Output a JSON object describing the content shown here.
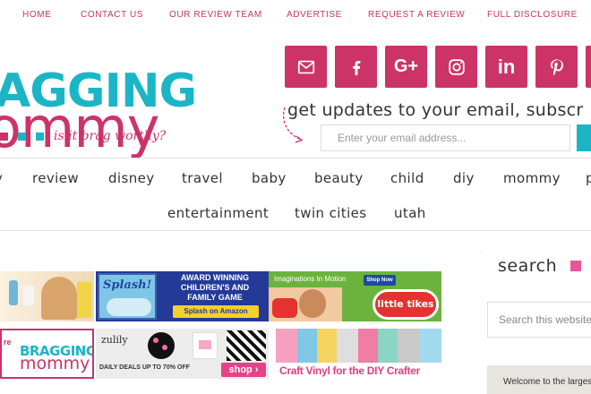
{
  "top_nav": [
    "HOME",
    "CONTACT US",
    "OUR REVIEW TEAM",
    "ADVERTISE",
    "REQUEST A REVIEW",
    "FULL DISCLOSURE"
  ],
  "logo": {
    "line1": "AGGING",
    "line2": "ommy",
    "tagline": "is it brag worthy?"
  },
  "social_icons": [
    "email-icon",
    "facebook-icon",
    "google-plus-icon",
    "instagram-icon",
    "linkedin-icon",
    "pinterest-icon"
  ],
  "social_labels": {
    "google_plus": "G+",
    "linkedin": "in"
  },
  "newsletter": {
    "heading": "get updates to your email, subscr",
    "placeholder": "Enter your email address..."
  },
  "categories_row1": [
    "review",
    "disney",
    "travel",
    "baby",
    "beauty",
    "child",
    "diy",
    "mommy"
  ],
  "categories_row2": [
    "entertainment",
    "twin cities",
    "utah"
  ],
  "ads": {
    "splash_title": "Splash!",
    "splash_award": "AWARD WINNING CHILDREN'S AND FAMILY GAME",
    "splash_cta": "Splash on Amazon",
    "littletikes_title": "Imaginations In Motion",
    "littletikes_cta": "Shop Now",
    "littletikes_logo": "little tikes",
    "bm_small_prefix": "re",
    "bm_small_logo1": "BRAGGING",
    "bm_small_logo2": "mommy",
    "zulily_logo": "zulily",
    "zulily_deal": "DAILY DEALS UP TO 70% OFF",
    "zulily_cta": "shop",
    "craft_text": "Craft Vinyl for the DIY Crafter"
  },
  "sidebar": {
    "search_title": "search",
    "search_placeholder": "Search this website",
    "welcome_text": "Welcome to the larges"
  },
  "colors": {
    "pink": "#cc3366",
    "teal": "#1bb5c6"
  }
}
